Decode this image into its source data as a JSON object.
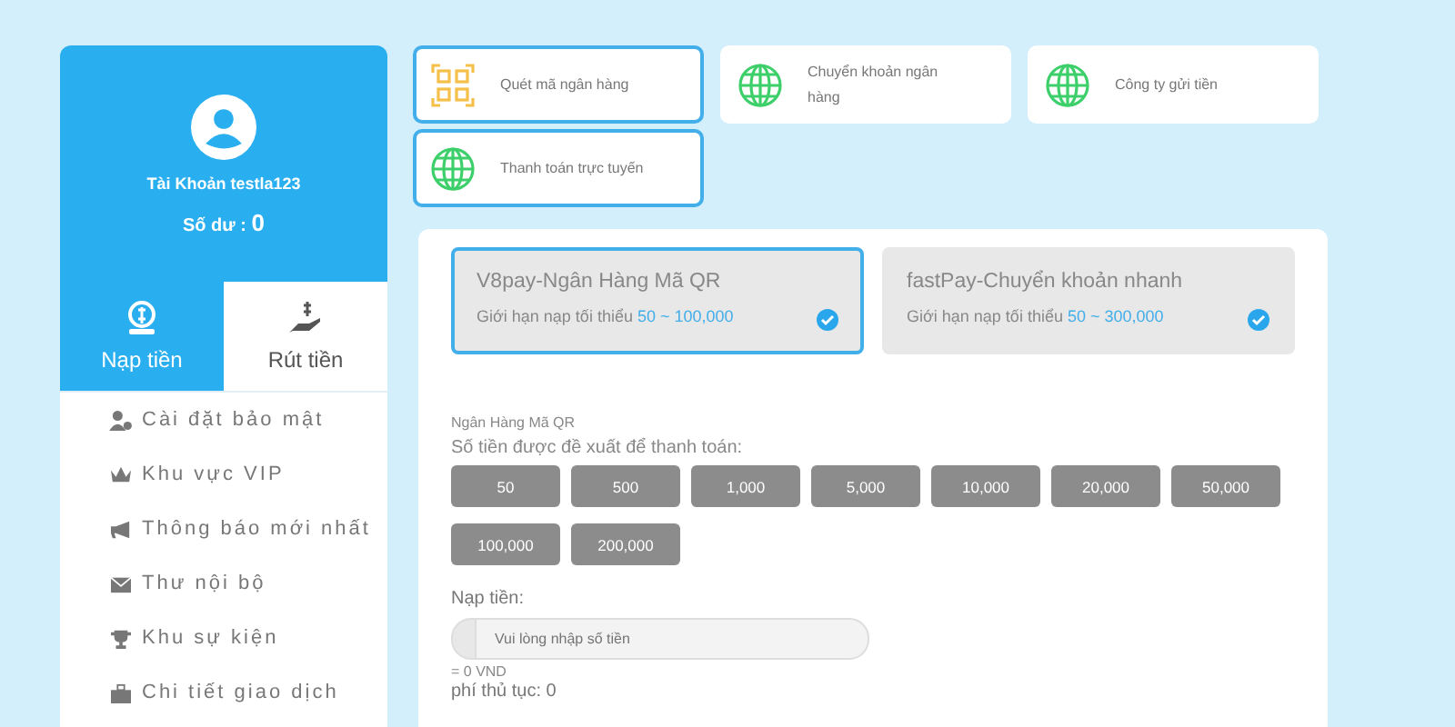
{
  "profile": {
    "account": "Tài Khoản testla123",
    "balance_label": "Số dư :",
    "balance": "0"
  },
  "tabs": [
    {
      "label": "Nạp tiền",
      "kind": "deposit",
      "selected": true
    },
    {
      "label": "Rút tiền",
      "kind": "withdraw",
      "selected": false
    }
  ],
  "menu": [
    {
      "label": "Cài đặt bảo mật",
      "kind": "user"
    },
    {
      "label": "Khu vực VIP",
      "kind": "crown"
    },
    {
      "label": "Thông báo mới nhất",
      "kind": "megaphone"
    },
    {
      "label": "Thư nội bộ",
      "kind": "mail"
    },
    {
      "label": "Khu sự kiện",
      "kind": "trophy"
    },
    {
      "label": "Chi tiết giao dịch",
      "kind": "bag"
    }
  ],
  "methods": [
    {
      "label": "Quét mã ngân hàng",
      "kind": "qr",
      "selected": true
    },
    {
      "label": "Chuyển khoản ngân hàng",
      "kind": "globe",
      "selected": false
    },
    {
      "label": "Công ty gửi tiền",
      "kind": "globe",
      "selected": false
    },
    {
      "label": "Thanh toán trực tuyến",
      "kind": "globe",
      "selected": true
    }
  ],
  "channels": [
    {
      "name": "V8pay-Ngân Hàng Mã QR",
      "limit_label": "Giới hạn nạp tối thiểu",
      "limit": "50 ~ 100,000",
      "selected": true
    },
    {
      "name": "fastPay-Chuyển khoản nhanh",
      "limit_label": "Giới hạn nạp tối thiểu",
      "limit": "50 ~ 300,000",
      "selected": false
    }
  ],
  "channel_title": "Ngân Hàng Mã QR",
  "amounts_label": "Số tiền được đề xuất để thanh toán:",
  "amounts": [
    "50",
    "500",
    "1,000",
    "5,000",
    "10,000",
    "20,000",
    "50,000",
    "100,000",
    "200,000"
  ],
  "deposit": {
    "label": "Nạp tiền:",
    "placeholder": "Vui lòng nhập số tiền",
    "converted": "= 0 VND",
    "fee_label": "phí thủ tục:",
    "fee": "0"
  }
}
